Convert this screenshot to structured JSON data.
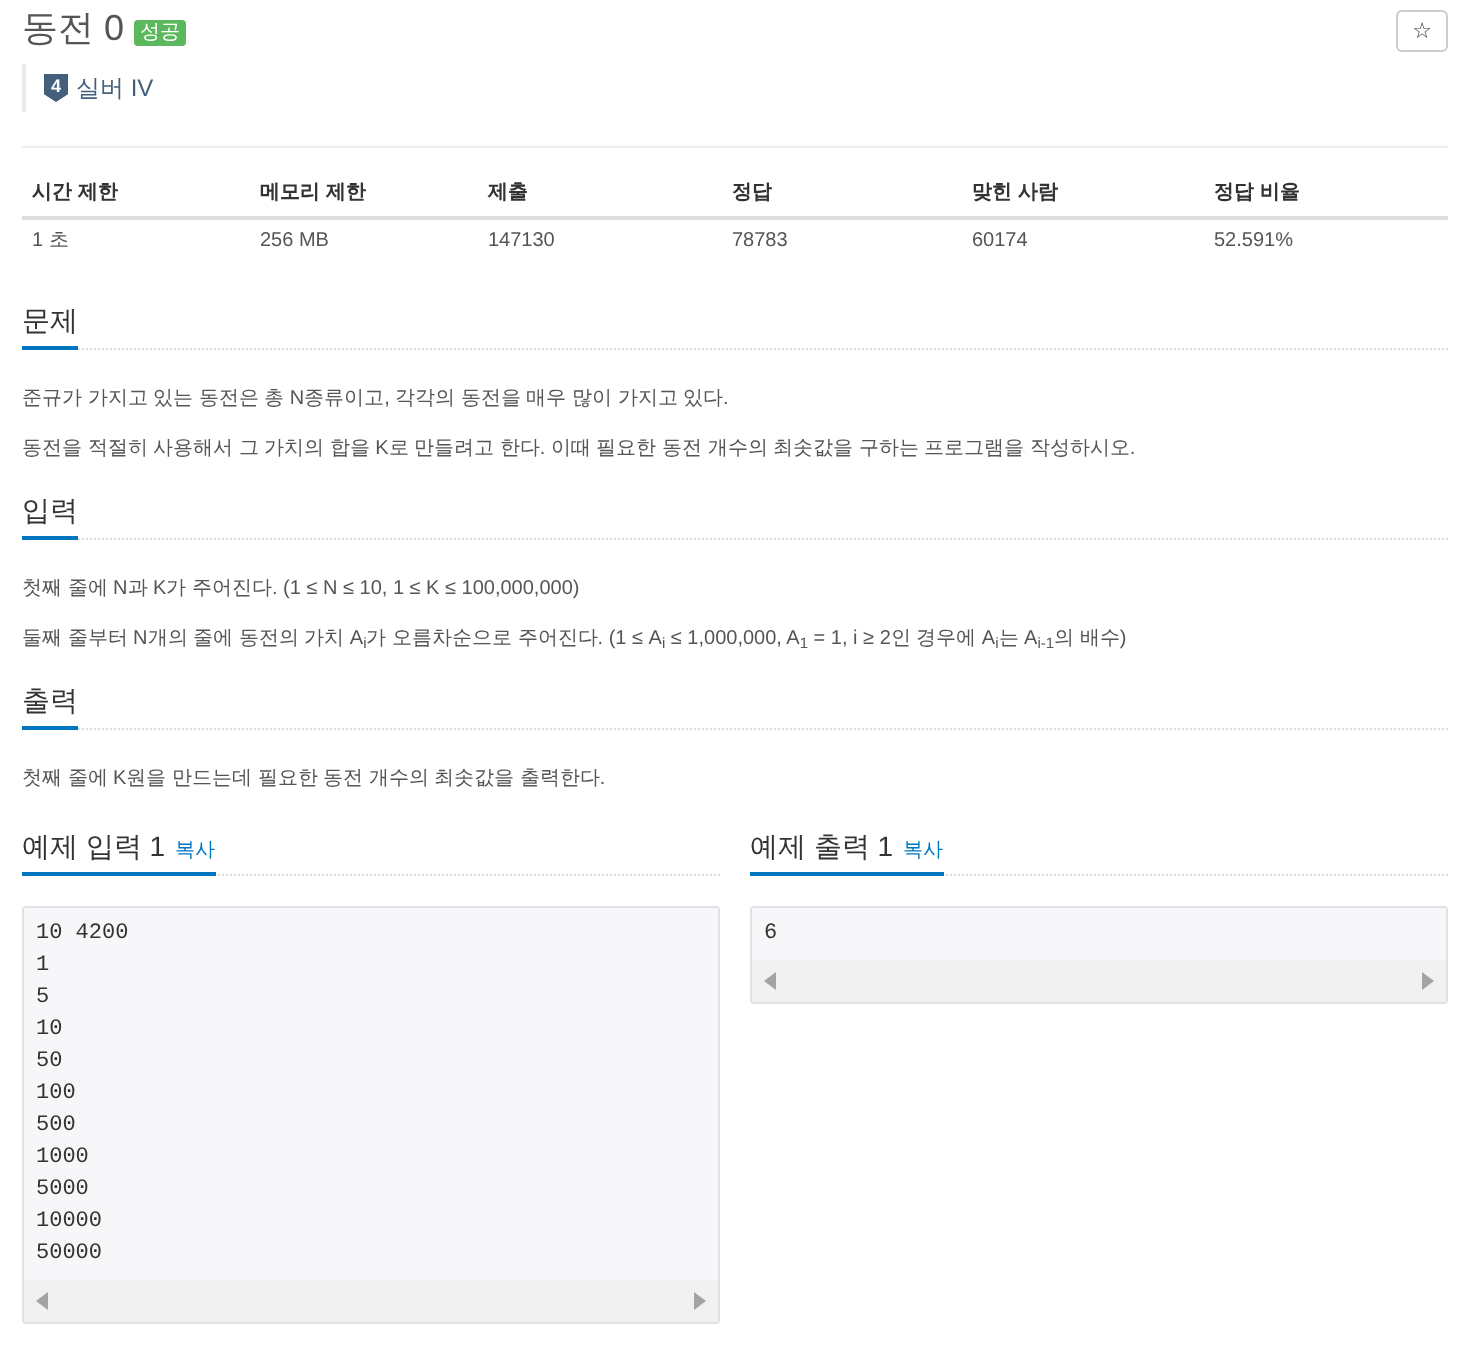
{
  "problem": {
    "title": "동전 0",
    "result_badge": "성공",
    "star_button": "☆"
  },
  "tier": {
    "level": "4",
    "name": "실버 IV"
  },
  "info_table": {
    "columns": [
      "시간 제한",
      "메모리 제한",
      "제출",
      "정답",
      "맞힌 사람",
      "정답 비율"
    ],
    "rows": [
      [
        "1 초",
        "256 MB",
        "147130",
        "78783",
        "60174",
        "52.591%"
      ]
    ]
  },
  "sections": [
    {
      "heading": "문제",
      "paragraphs": [
        "준규가 가지고 있는 동전은 총 N종류이고, 각각의 동전을 매우 많이 가지고 있다.",
        "동전을 적절히 사용해서 그 가치의 합을 K로 만들려고 한다. 이때 필요한 동전 개수의 최솟값을 구하는 프로그램을 작성하시오."
      ]
    },
    {
      "heading": "입력",
      "paragraphs": [
        "첫째 줄에 N과 K가 주어진다. (1 ≤ N ≤ 10, 1 ≤ K ≤ 100,000,000)",
        "둘째 줄부터 N개의 줄에 동전의 가치 A$_{i}$가 오름차순으로 주어진다. (1 ≤ A$_{i}$ ≤ 1,000,000, A$_{1}$ = 1, i ≥ 2인 경우에 A$_{i}$는 A$_{i-1}$의 배수)"
      ]
    },
    {
      "heading": "출력",
      "paragraphs": [
        "첫째 줄에 K원을 만드는데 필요한 동전 개수의 최솟값을 출력한다."
      ]
    }
  ],
  "samples": [
    {
      "heading": "예제 입력 1",
      "copy_link": "복사",
      "text": "10 4200\n1\n5\n10\n50\n100\n500\n1000\n5000\n10000\n50000"
    },
    {
      "heading": "예제 출력 1",
      "copy_link": "복사",
      "text": "6"
    }
  ]
}
